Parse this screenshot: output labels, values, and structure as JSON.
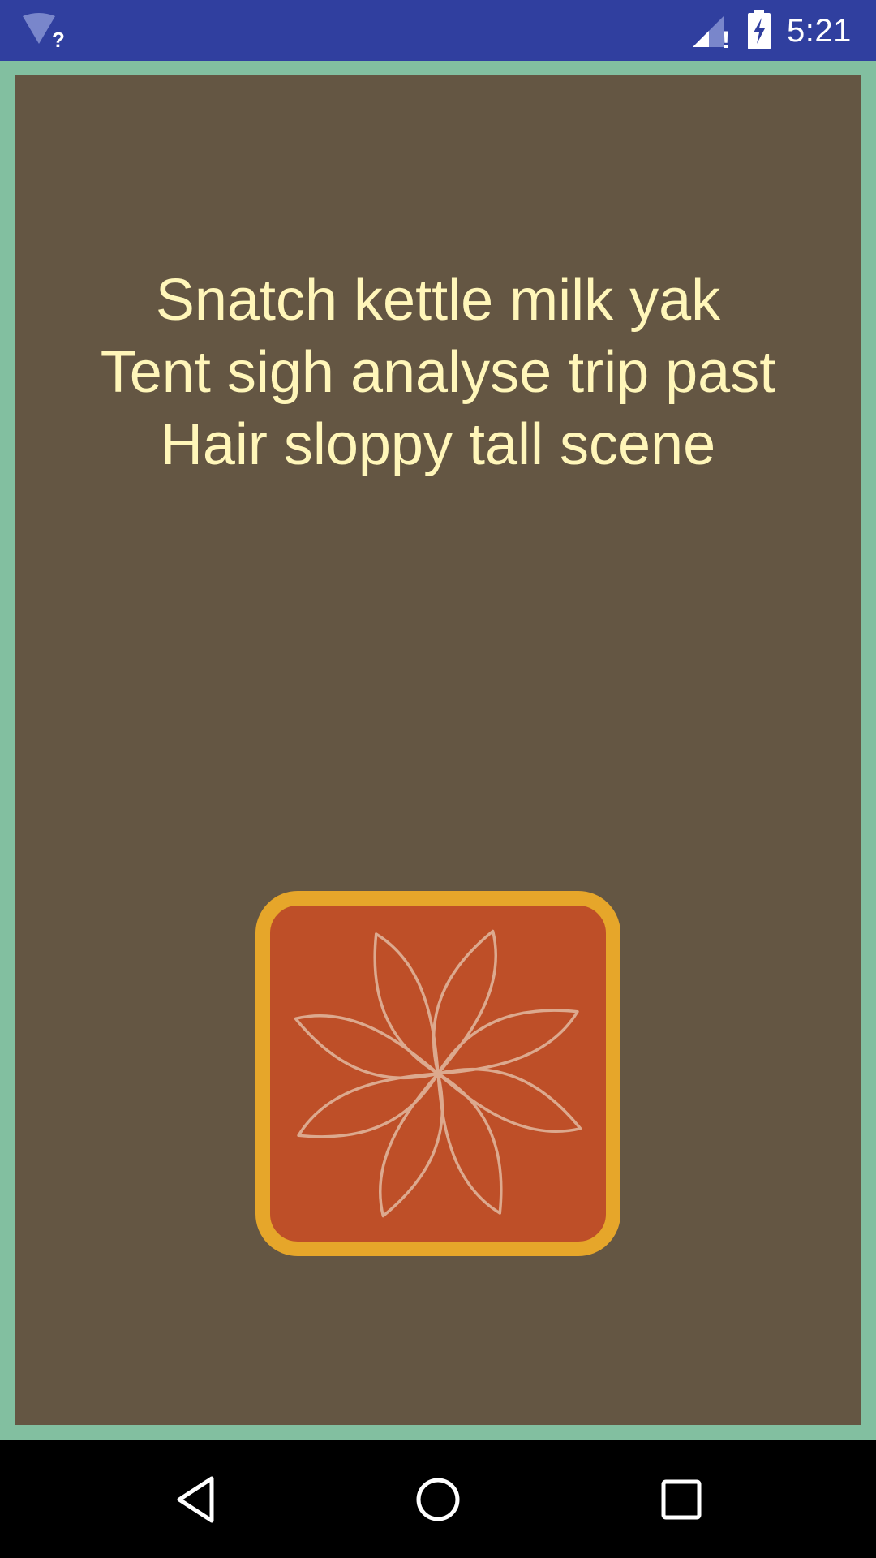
{
  "status_bar": {
    "time": "5:21",
    "wifi_badge": "?",
    "signal_badge": "!",
    "icons": [
      "wifi-unknown-icon",
      "signal-alert-icon",
      "battery-charging-icon"
    ]
  },
  "message": {
    "lines": [
      "Snatch kettle milk yak",
      "Tent sigh analyse trip past",
      "Hair sloppy tall scene"
    ]
  },
  "tile": {
    "icon": "flower-icon"
  },
  "nav_bar": {
    "icons": [
      "back-icon",
      "home-icon",
      "recents-icon"
    ]
  },
  "colors": {
    "status_bar": "#303F9F",
    "frame": "#82BFA0",
    "panel": "#645643",
    "text": "#FFF6B9",
    "tile_border": "#E6A62A",
    "tile_fill": "#BE4F28",
    "flower_stroke": "#E0B39A"
  }
}
